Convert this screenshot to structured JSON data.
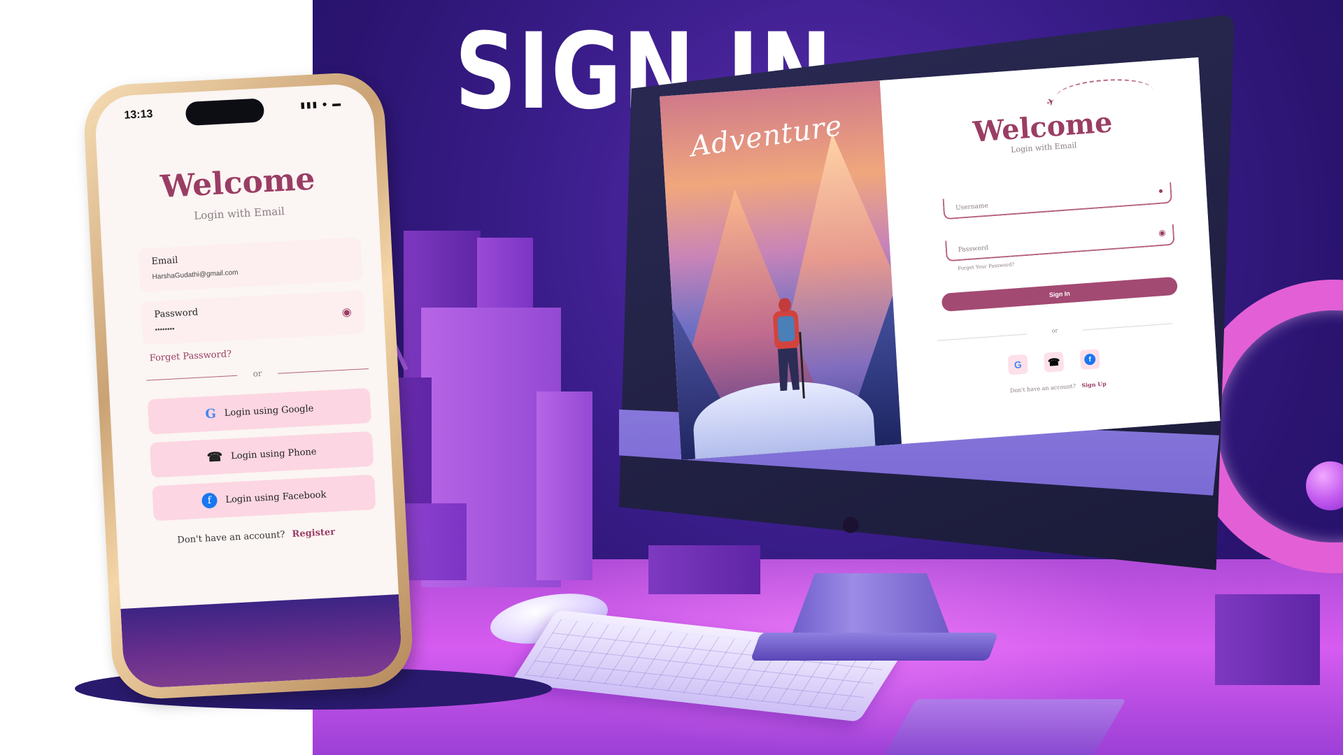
{
  "heading": "SIGN IN",
  "colors": {
    "accent": "#9a3d64",
    "button": "#a34a72",
    "social_bg": "#fcd6e2",
    "scene_bg": "#3a1d8a"
  },
  "phone": {
    "status_time": "13:13",
    "title": "Welcome",
    "subtitle": "Login with Email",
    "email_label": "Email",
    "email_value": "HarshaGudathi@gmail.com",
    "password_label": "Password",
    "password_value": "••••••••",
    "forgot": "Forget Password?",
    "or": "or",
    "google": "Login using Google",
    "phone_login": "Login using Phone",
    "facebook": "Login using Facebook",
    "no_account": "Don't have an account?",
    "register": "Register",
    "icons": [
      "google-icon",
      "phone-icon",
      "facebook-icon",
      "eye-icon"
    ]
  },
  "desktop": {
    "hero_text": "Adventure",
    "title": "Welcome",
    "subtitle": "Login with Email",
    "username_label": "Username",
    "password_label": "Password",
    "forgot": "Forget Your Password?",
    "signin": "Sign In",
    "or": "or",
    "no_account": "Don't have an account?",
    "signup": "Sign Up",
    "icons": [
      "user-icon",
      "eye-icon",
      "google-icon",
      "phone-icon",
      "facebook-icon",
      "plane-icon",
      "apple-logo-icon"
    ]
  }
}
